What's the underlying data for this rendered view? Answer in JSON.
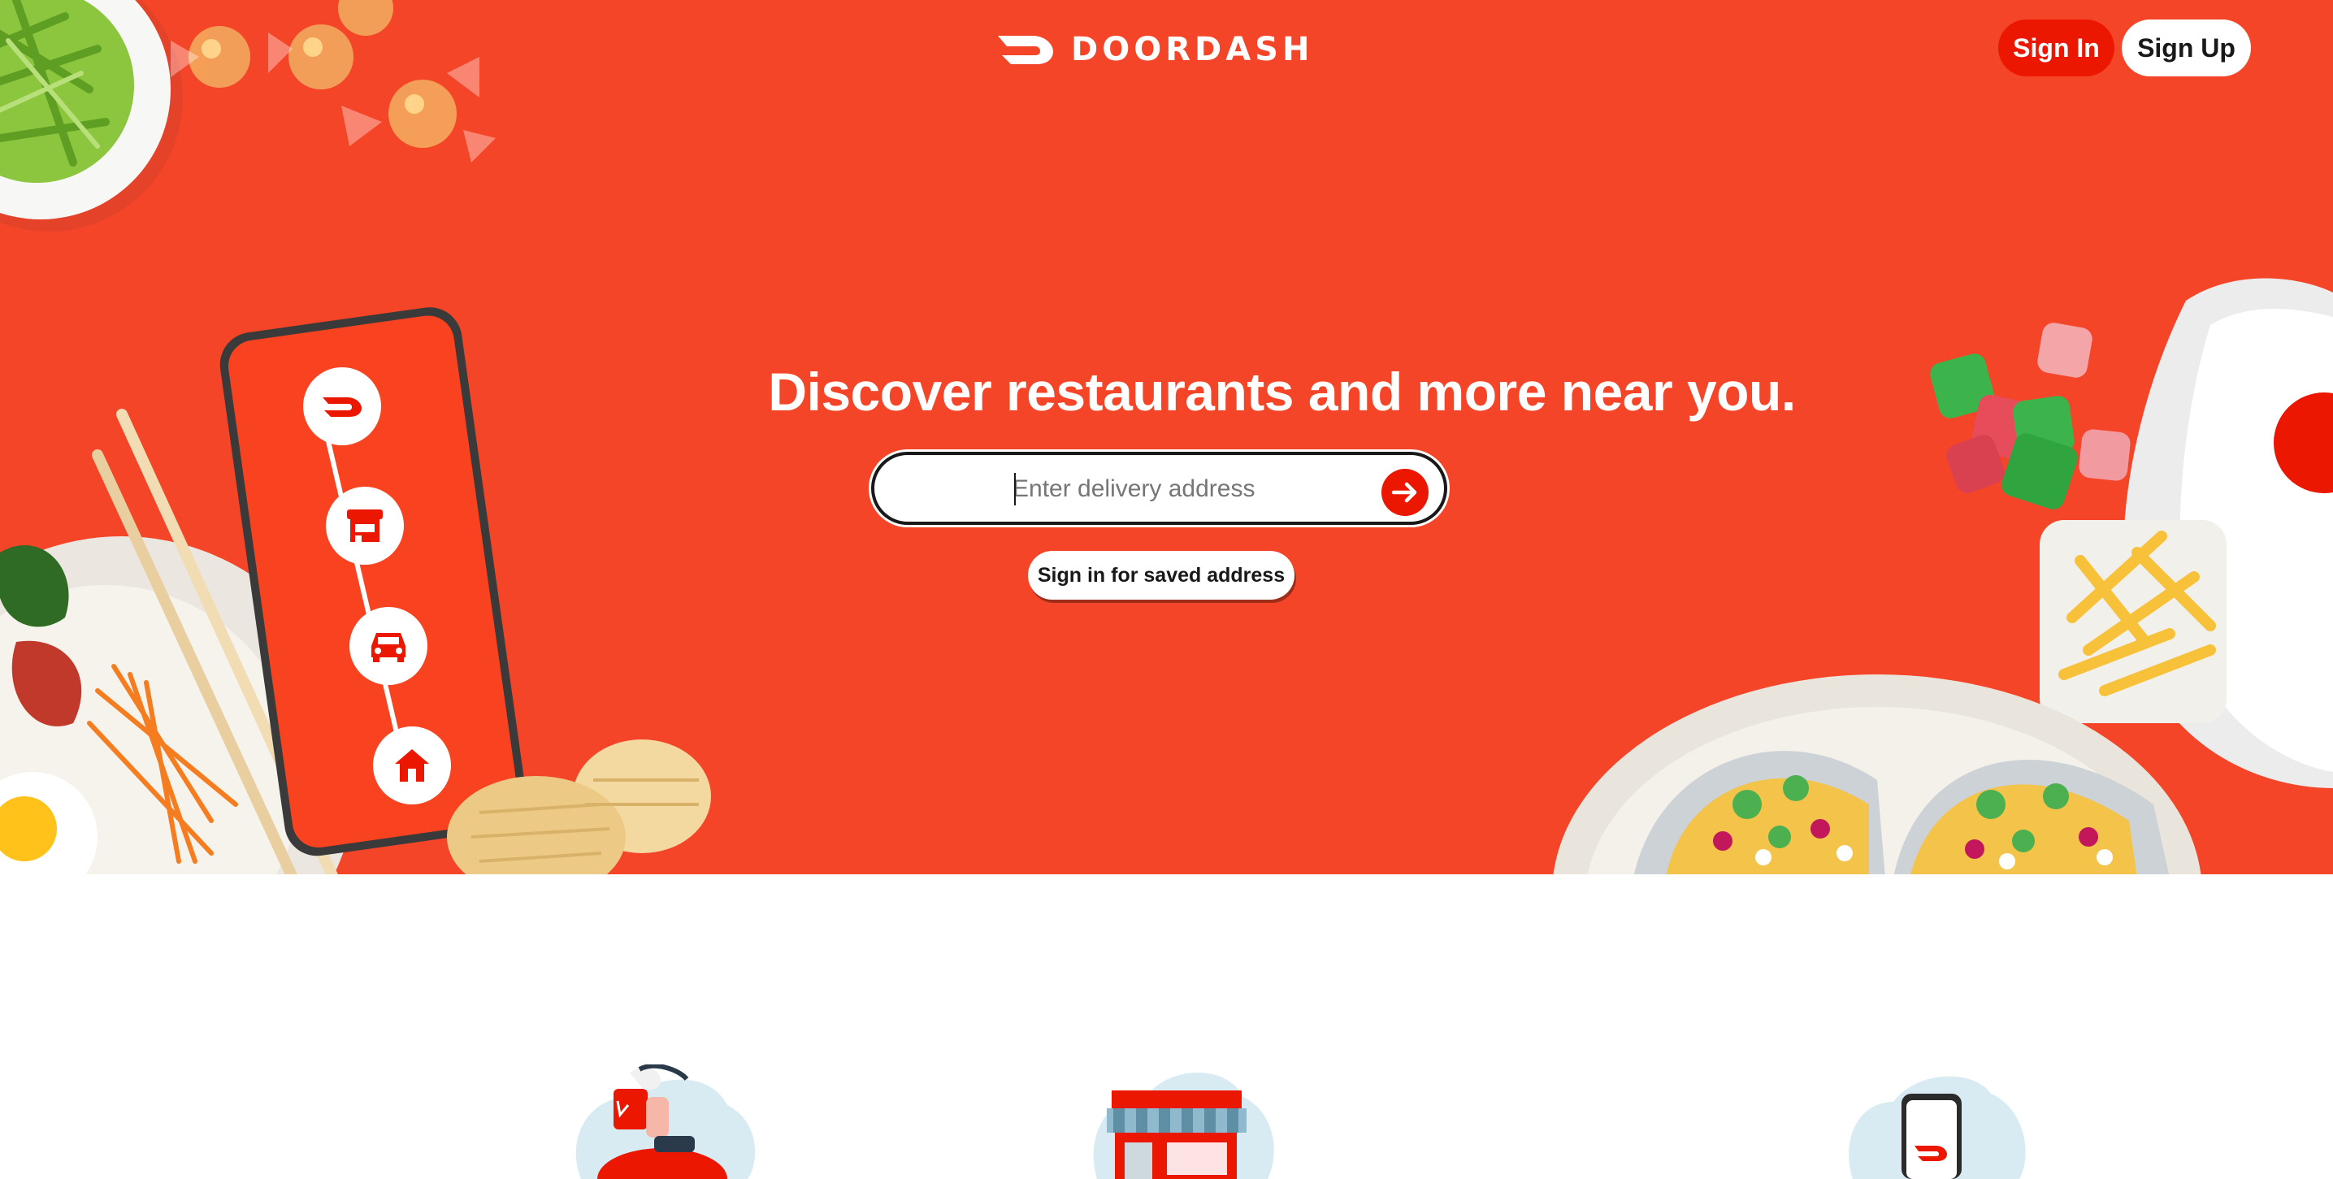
{
  "header": {
    "brand": "DOORDASH",
    "sign_in_label": "Sign In",
    "sign_up_label": "Sign Up"
  },
  "hero": {
    "headline": "Discover restaurants and more near you.",
    "address_placeholder": "Enter delivery address",
    "saved_address_label": "Sign in for saved address"
  },
  "phone_steps": [
    "doordash-logo-icon",
    "store-icon",
    "car-icon",
    "home-icon"
  ],
  "features": [
    "courier-on-scooter-illustration",
    "storefront-illustration",
    "phone-app-illustration"
  ],
  "colors": {
    "brand_red": "#eb1700",
    "hero_background": "#f44528",
    "text_dark": "#191919"
  }
}
